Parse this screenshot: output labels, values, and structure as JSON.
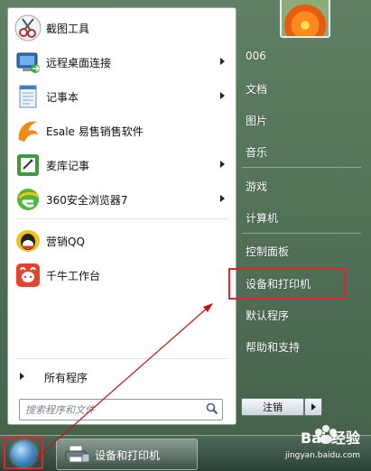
{
  "start_menu": {
    "programs": [
      {
        "label": "截图工具",
        "icon": "scissors-icon",
        "has_submenu": false
      },
      {
        "label": "远程桌面连接",
        "icon": "remote-desktop-icon",
        "has_submenu": true
      },
      {
        "label": "记事本",
        "icon": "notepad-icon",
        "has_submenu": true
      },
      {
        "label": "Esale 易售销售软件",
        "icon": "esale-icon",
        "has_submenu": false
      },
      {
        "label": "麦库记事",
        "icon": "memo-icon",
        "has_submenu": true
      },
      {
        "label": "360安全浏览器7",
        "icon": "browser-360-icon",
        "has_submenu": true
      },
      {
        "label": "营销QQ",
        "icon": "qq-icon",
        "has_submenu": false
      },
      {
        "label": "千牛工作台",
        "icon": "qianniu-icon",
        "has_submenu": false
      }
    ],
    "all_programs_label": "所有程序",
    "search_placeholder": "搜索程序和文件",
    "right_items": [
      {
        "label": "006"
      },
      {
        "label": "文档"
      },
      {
        "label": "图片"
      },
      {
        "label": "音乐"
      },
      {
        "label": "游戏"
      },
      {
        "label": "计算机"
      },
      {
        "label": "控制面板"
      },
      {
        "label": "设备和打印机",
        "highlighted": true
      },
      {
        "label": "默认程序"
      },
      {
        "label": "帮助和支持"
      }
    ],
    "shutdown_label": "注销"
  },
  "taskbar": {
    "task_label": "设备和打印机"
  },
  "watermark": {
    "brand": "Bai 经验",
    "url": "jingyan.baidu.com"
  },
  "colors": {
    "highlight": "#e0262c",
    "annotation_arrow": "#c0141c"
  }
}
